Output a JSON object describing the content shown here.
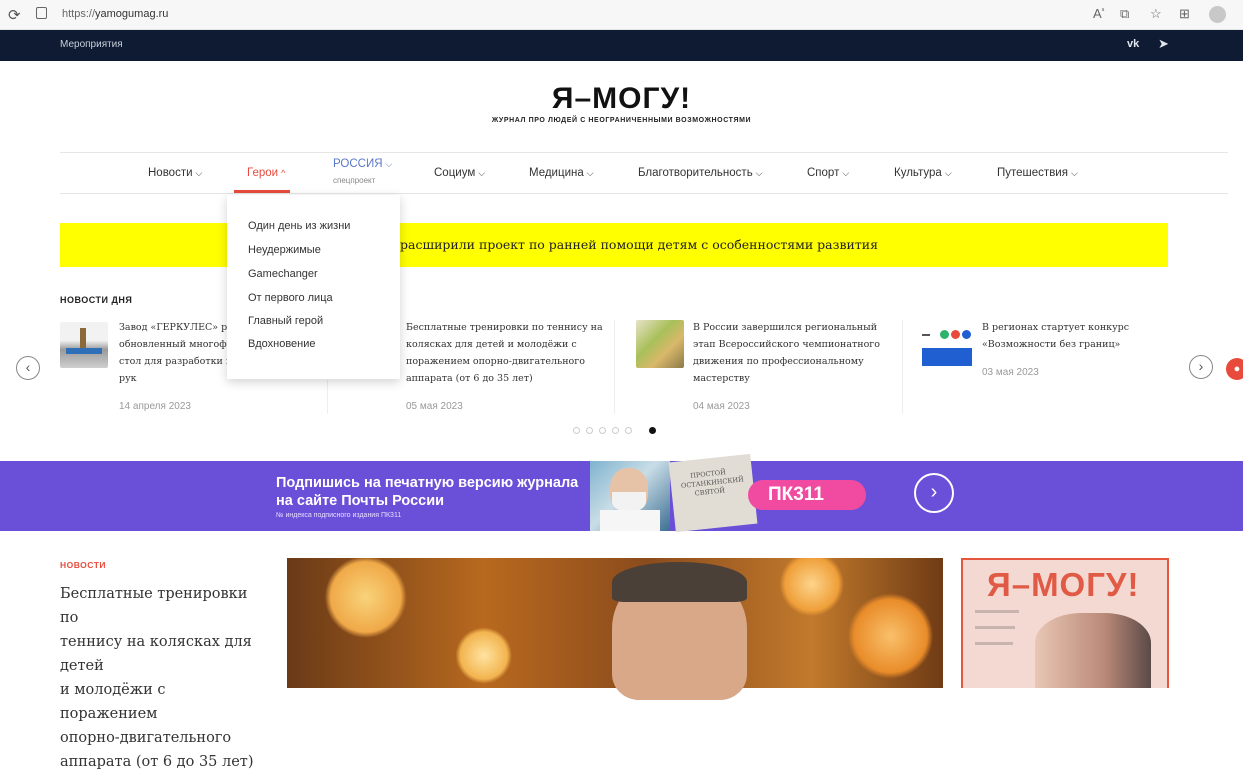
{
  "browser": {
    "url": "https://yamogumag.ru",
    "url_scheme": "https://",
    "url_host": "yamogumag.ru",
    "reload_icon": "reload-icon",
    "lock_icon": "lock-icon"
  },
  "topbar": {
    "events_link": "Мероприятия",
    "vk": "vk",
    "telegram_icon": "telegram-icon"
  },
  "header": {
    "logo": "Я–МОГУ!",
    "tagline": "ЖУРНАЛ ПРО ЛЮДЕЙ С НЕОГРАНИЧЕННЫМИ ВОЗМОЖНОСТЯМИ"
  },
  "nav": {
    "items": [
      "Новости",
      "Герои",
      "Социум",
      "Медицина",
      "Благотворительность",
      "Спорт",
      "Культура",
      "Путешествия"
    ],
    "russia": {
      "label": "РОССИЯ",
      "sub": "спецпроект"
    },
    "chevron_down": "⌵",
    "chevron_up": "^"
  },
  "dropdown": {
    "items": [
      "Один день из жизни",
      "Неудержимые",
      "Gamechanger",
      "От первого лица",
      "Главный герой",
      "Вдохновение"
    ]
  },
  "announcement": {
    "text": "расширили проект по ранней помощи детям с особенностями развития",
    "color": "#ffff00"
  },
  "news_day": {
    "label": "НОВОСТИ ДНЯ",
    "cards": [
      {
        "title_lines": [
          "Завод «ГЕРКУЛЕС» ра",
          "обновленный многофу",
          "стол для разработки м",
          "рук"
        ],
        "date": "14 апреля 2023"
      },
      {
        "title_lines": [
          "Бесплатные тренировки по теннису на",
          "колясках для детей и молодёжи с",
          "поражением опорно-двигательного",
          "аппарата (от 6 до 35 лет)"
        ],
        "date": "05 мая 2023"
      },
      {
        "title_lines": [
          "В России завершился региональный",
          "этап Всероссийского чемпионатного",
          "движения по профессиональному",
          "мастерству"
        ],
        "date": "04 мая 2023"
      },
      {
        "title_lines": [
          "В регионах стартует конкурс",
          "«Возможности без границ»"
        ],
        "date": "03 мая 2023"
      }
    ],
    "prev_icon": "‹",
    "next_icon": "›",
    "active_dot": 6,
    "dot_count": 6
  },
  "subscribe": {
    "line1": "Подпишись на печатную версию журнала",
    "line2": "на сайте Почты России",
    "small": "№ индекса подписного издания ПК311",
    "code": "ПК311",
    "paper_text": "ПРОСТОЙ ОСТАНКИНСКИЙ СВЯТОЙ",
    "accent": "#6a4fd9"
  },
  "feature": {
    "label": "НОВОСТИ",
    "title_lines": [
      "Бесплатные тренировки по",
      "теннису на колясках для детей",
      "и молодёжи с поражением",
      "опорно-двигательного",
      "аппарата (от 6 до 35 лет)"
    ]
  },
  "magazine": {
    "logo": "Я–МОГУ!"
  },
  "colors": {
    "accent_red": "#e84b3c",
    "dark_bar": "#0f1b33",
    "russia_blue": "#5a78c8"
  }
}
